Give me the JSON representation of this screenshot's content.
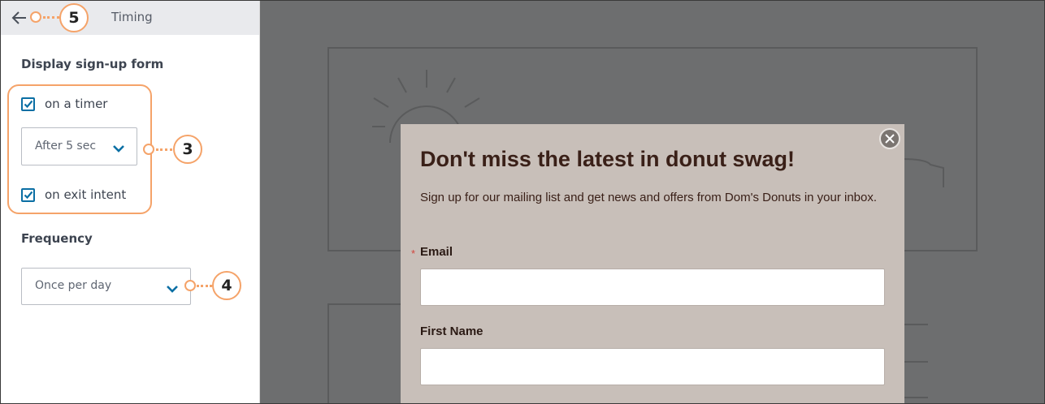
{
  "sidebar": {
    "header_title": "Timing",
    "display_section_title": "Display sign-up form",
    "timer_checkbox": {
      "label": "on a timer",
      "checked": true
    },
    "timer_select": {
      "value": "After 5 sec"
    },
    "exit_checkbox": {
      "label": "on exit intent",
      "checked": true
    },
    "frequency_title": "Frequency",
    "frequency_select": {
      "value": "Once per day"
    }
  },
  "callouts": {
    "three": "3",
    "four": "4",
    "five": "5"
  },
  "popup": {
    "heading": "Don't miss the latest in donut swag!",
    "body": "Sign up for our mailing list and get news and offers from Dom's Donuts in your inbox.",
    "required_marker": "*",
    "email_label": "Email",
    "first_name_label": "First Name"
  },
  "colors": {
    "accent": "#0b6fa4",
    "callout": "#f5a369",
    "modal_bg": "#c8bfb9",
    "overlay": "#6d6e6f",
    "heading_text": "#3a2018"
  },
  "icons": {
    "back": "arrow-left-icon",
    "check": "checkmark-icon",
    "chevron": "chevron-down-icon",
    "close": "close-icon"
  }
}
